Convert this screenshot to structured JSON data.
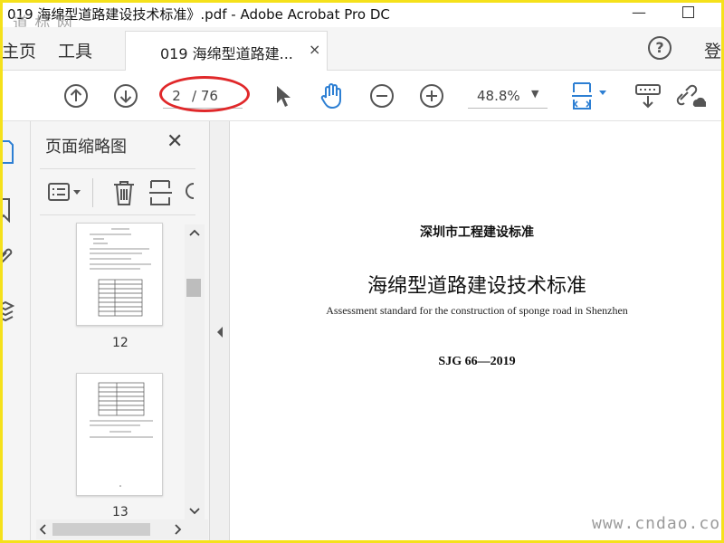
{
  "window": {
    "title": "019 海绵型道路建设技术标准》.pdf - Adobe Acrobat Pro DC",
    "watermark_logo": "道 标 网",
    "minimize": "—"
  },
  "tabs": {
    "home": "主页",
    "tools": "工具",
    "document": "019 海绵型道路建...",
    "close": "×",
    "help": "?",
    "login": "登"
  },
  "toolbar": {
    "page_current": "2",
    "page_total": "/ 76",
    "zoom": "48.8%",
    "zoom_caret": "▼"
  },
  "thumbnail_panel": {
    "title": "页面缩略图",
    "close": "✕",
    "pages": [
      {
        "label": "12"
      },
      {
        "label": "13"
      }
    ]
  },
  "document": {
    "org": "深圳市工程建设标准",
    "title": "海绵型道路建设技术标准",
    "subtitle_en": "Assessment standard for the construction of sponge road in Shenzhen",
    "code": "SJG 66—2019"
  },
  "footer_watermark": "www.cndao.com",
  "colors": {
    "frame": "#f5e11b",
    "accent_blue": "#2d7fd3",
    "annotation_red": "#e0282a"
  }
}
